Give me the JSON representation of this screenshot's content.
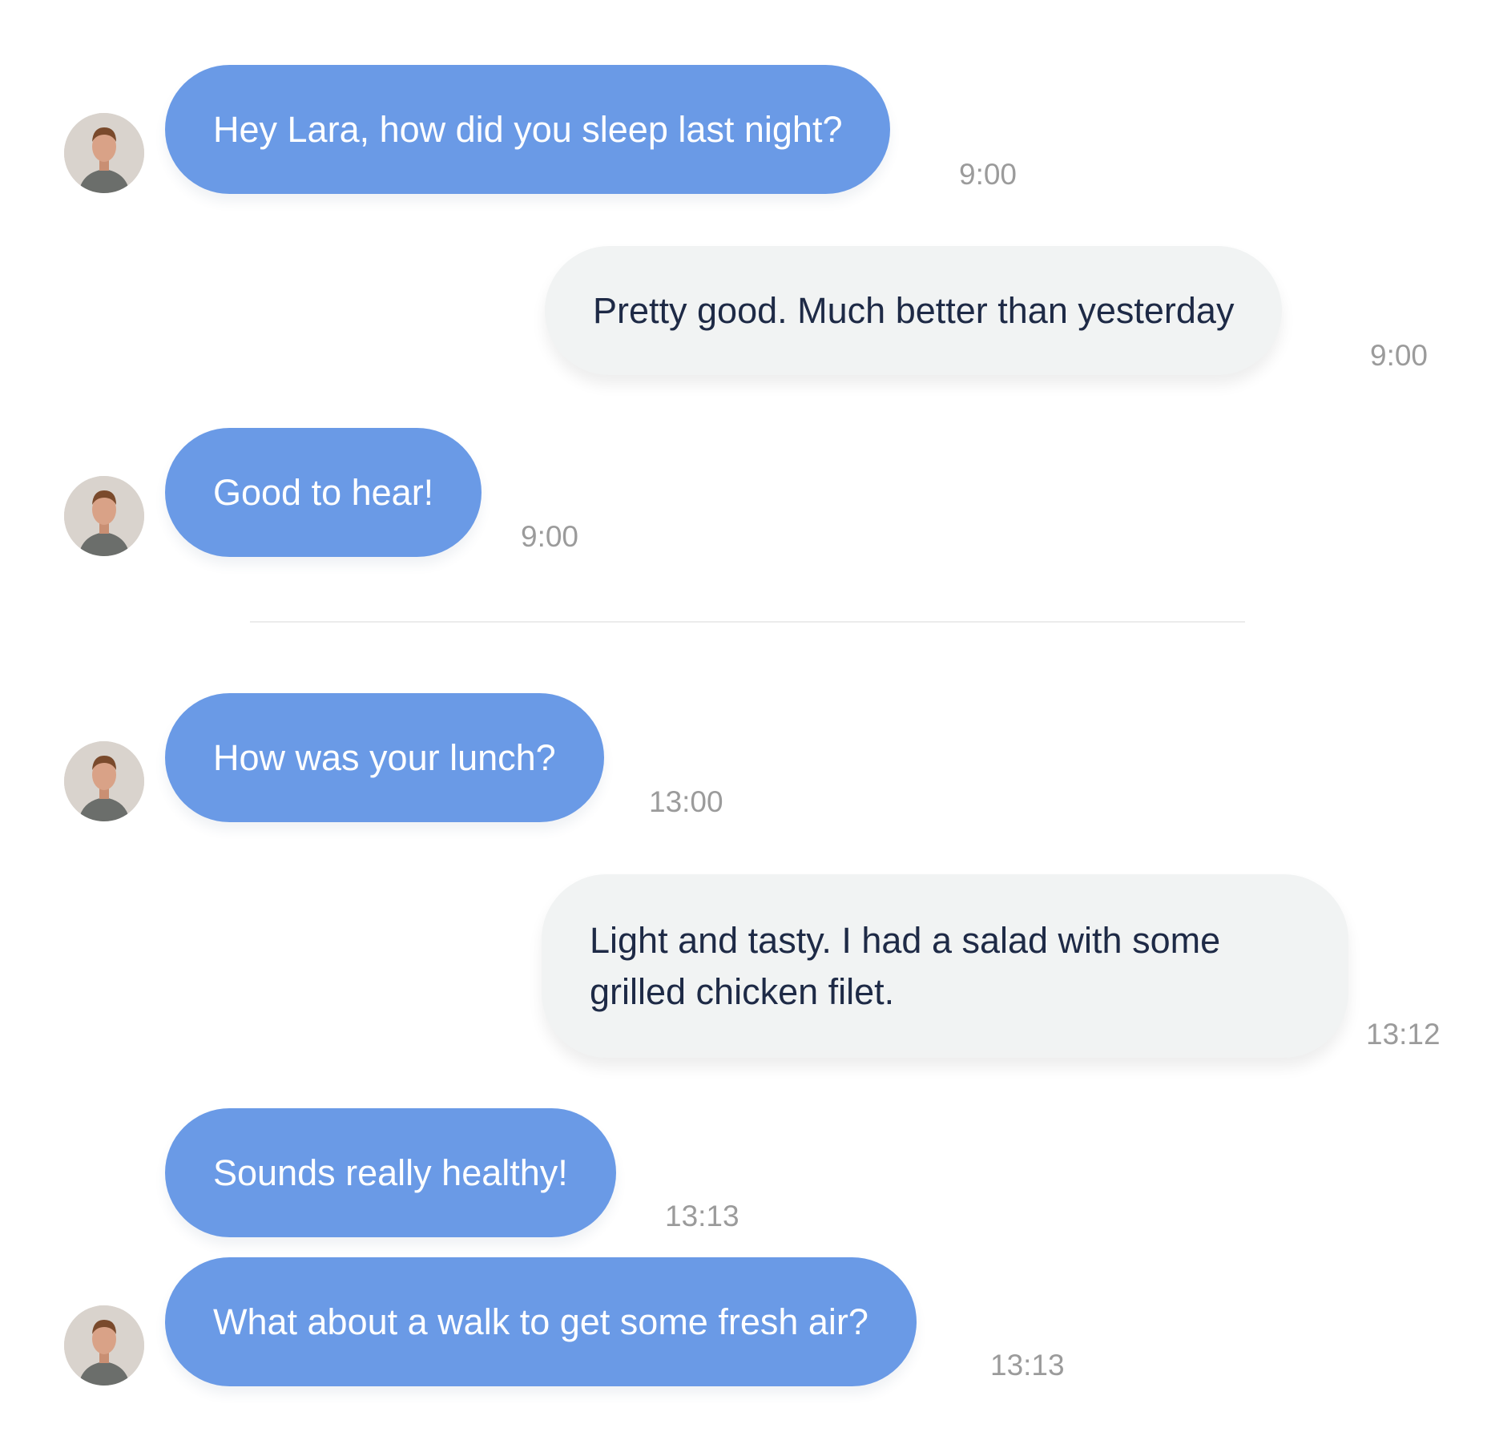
{
  "colors": {
    "incoming_bubble": "#6a9ae6",
    "outgoing_bubble": "#f1f3f3",
    "outgoing_text": "#1e2a46",
    "timestamp": "#9b9b9b"
  },
  "messages": [
    {
      "sender": "contact",
      "text": "Hey Lara, how did you sleep last night?",
      "time": "9:00",
      "avatar": "avatar-photo"
    },
    {
      "sender": "me",
      "text": "Pretty good. Much better than yesterday",
      "time": "9:00"
    },
    {
      "sender": "contact",
      "text": "Good to hear!",
      "time": "9:00",
      "avatar": "avatar-photo"
    },
    {
      "sender": "contact",
      "text": "How was your lunch?",
      "time": "13:00",
      "avatar": "avatar-photo"
    },
    {
      "sender": "me",
      "text": "Light and tasty. I had a salad with some grilled chicken filet.",
      "time": "13:12"
    },
    {
      "sender": "contact",
      "text": "Sounds really healthy!",
      "time": "13:13"
    },
    {
      "sender": "contact",
      "text": "What about a walk to get some fresh air?",
      "time": "13:13",
      "avatar": "avatar-photo"
    }
  ]
}
